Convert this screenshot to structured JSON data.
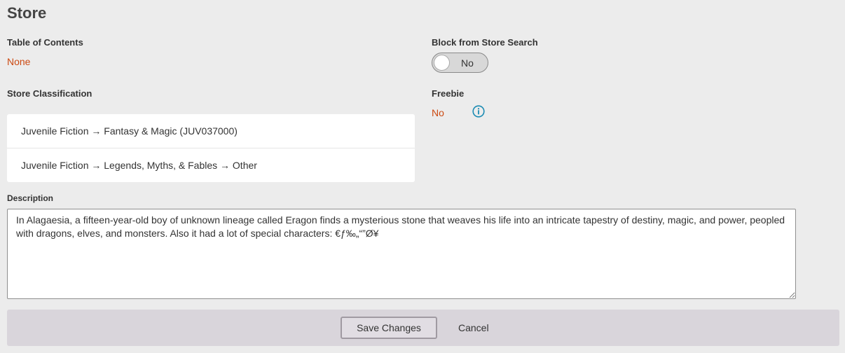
{
  "page": {
    "title": "Store"
  },
  "toc": {
    "label": "Table of Contents",
    "value": "None"
  },
  "classification": {
    "label": "Store Classification",
    "items": [
      {
        "label": "Juvenile Fiction → Fantasy & Magic (JUV037000)"
      },
      {
        "label": "Juvenile Fiction → Legends, Myths, & Fables → Other"
      }
    ]
  },
  "block_search": {
    "label": "Block from Store Search",
    "toggle_text": "No",
    "state": "off"
  },
  "freebie": {
    "label": "Freebie",
    "value": "No",
    "info_icon": "info-icon"
  },
  "description": {
    "label": "Description",
    "value": "In Alagaesia, a fifteen-year-old boy of unknown lineage called Eragon finds a mysterious stone that weaves his life into an intricate tapestry of destiny, magic, and power, peopled with dragons, elves, and monsters. Also it had a lot of special characters: €ƒ‰„“”Ø¥"
  },
  "footer": {
    "save_label": "Save Changes",
    "cancel_label": "Cancel"
  },
  "colors": {
    "accent_orange": "#cc4a12",
    "info_blue": "#1b8bb3"
  }
}
